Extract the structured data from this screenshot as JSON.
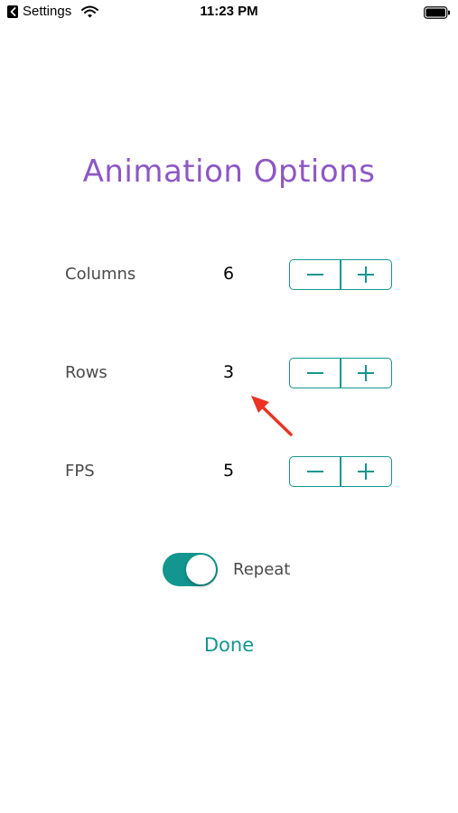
{
  "status_bar": {
    "back_app_label": "Settings",
    "time": "11:23 PM"
  },
  "title": "Animation Options",
  "options": [
    {
      "label": "Columns",
      "value": "6"
    },
    {
      "label": "Rows",
      "value": "3"
    },
    {
      "label": "FPS",
      "value": "5"
    }
  ],
  "stepper": {
    "decrement_icon": "minus-icon",
    "increment_icon": "plus-icon"
  },
  "repeat": {
    "label": "Repeat",
    "enabled": true
  },
  "done_label": "Done",
  "colors": {
    "title": "#8e57c4",
    "accent": "#13968f",
    "label_text": "#4a4a4a",
    "annotation_arrow": "#ea3323"
  }
}
